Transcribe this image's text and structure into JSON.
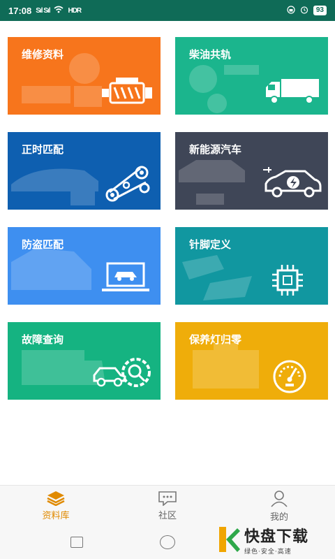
{
  "status": {
    "time": "17:08",
    "signal": "Sıl Sıl",
    "hd": "HDR",
    "battery": "93"
  },
  "cards": [
    {
      "id": "repair",
      "label": "维修资料",
      "color": "#f7751c"
    },
    {
      "id": "diesel",
      "label": "柴油共轨",
      "color": "#1bb58d"
    },
    {
      "id": "timing",
      "label": "正时匹配",
      "color": "#0e5fb0"
    },
    {
      "id": "ev",
      "label": "新能源汽车",
      "color": "#3f4657"
    },
    {
      "id": "antitheft",
      "label": "防盗匹配",
      "color": "#3e8ff0"
    },
    {
      "id": "pin",
      "label": "针脚定义",
      "color": "#1197a0"
    },
    {
      "id": "fault",
      "label": "故障查询",
      "color": "#15b381"
    },
    {
      "id": "maint",
      "label": "保养灯归零",
      "color": "#efad0a"
    }
  ],
  "tabs": [
    {
      "label": "资料库",
      "icon": "layers-icon",
      "active": true
    },
    {
      "label": "社区",
      "icon": "chat-icon",
      "active": false
    },
    {
      "label": "我的",
      "icon": "user-icon",
      "active": false
    }
  ],
  "watermark": {
    "main": "快盘下载",
    "sub": "绿色·安全·高速"
  },
  "colors": {
    "statusbar": "#0f6b57",
    "accent": "#e08a00"
  }
}
